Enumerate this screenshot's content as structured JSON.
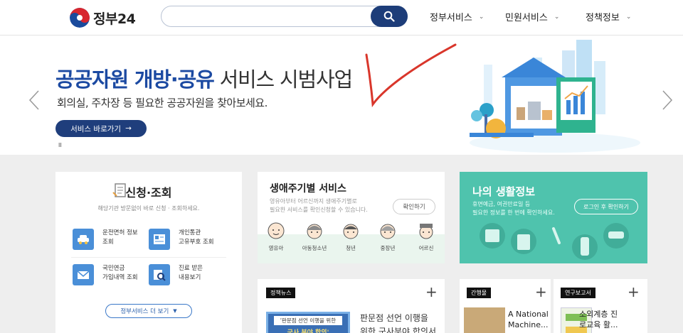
{
  "header": {
    "logo_text": "정부24",
    "search_placeholder": "",
    "nav": [
      {
        "label": "정부서비스"
      },
      {
        "label": "민원서비스"
      },
      {
        "label": "정책정보"
      }
    ]
  },
  "banner": {
    "title_highlight": "공공자원 개방·공유",
    "title_rest": " 서비스 시범사업",
    "subtitle": "회의실, 주차장 등 필요한 공공자원을 찾아보세요.",
    "button_label": "서비스 바로가기",
    "button_arrow": "→",
    "pager": "II"
  },
  "apply": {
    "title": "신청·조회",
    "description": "해당기관 방문없이 바로 신청 · 조회하세요.",
    "items": [
      {
        "line1": "운전면허 정보",
        "line2": "조회",
        "icon": "car-icon"
      },
      {
        "line1": "개인통관",
        "line2": "고유부호 조회",
        "icon": "id-card-icon"
      },
      {
        "line1": "국민연금",
        "line2": "가입내역 조회",
        "icon": "envelope-icon"
      },
      {
        "line1": "진료 받은",
        "line2": "내용보기",
        "icon": "medical-search-icon"
      }
    ],
    "more_label": "정부서비스 더 보기"
  },
  "life": {
    "title": "생애주기별 서비스",
    "description_line1": "영유아부터 어르신까지 생애주기별로",
    "description_line2": "필요한 서비스를 확인신청할 수 있습니다.",
    "button_label": "확인하기",
    "stages": [
      "영유아",
      "아동청소년",
      "청년",
      "중장년",
      "어르신"
    ]
  },
  "myinfo": {
    "title": "나의 생활정보",
    "description_line1": "휴면예금, 여권만료일 등",
    "description_line2": "필요한 정보를 한 번에 확인하세요.",
    "button_label": "로그인 후 확인하기"
  },
  "news": {
    "tag": "정책뉴스",
    "image_text_line1": "'판문점 선언 이행을 위한",
    "image_text_line2": "군사 분야 합의'",
    "text": "판문점 선언 이행을 위한 군사분야 합의서"
  },
  "publication": {
    "tag": "간행물",
    "text_line1": "A National",
    "text_line2": "Machine..."
  },
  "research": {
    "tag": "연구보고서",
    "text_line1": "소외계층 진",
    "text_line2": "로교육 활..."
  },
  "colors": {
    "primary_navy": "#1d3d79",
    "title_blue": "#1c4aa2",
    "mint": "#4fc3ad",
    "background_gray": "#eeeeee"
  }
}
